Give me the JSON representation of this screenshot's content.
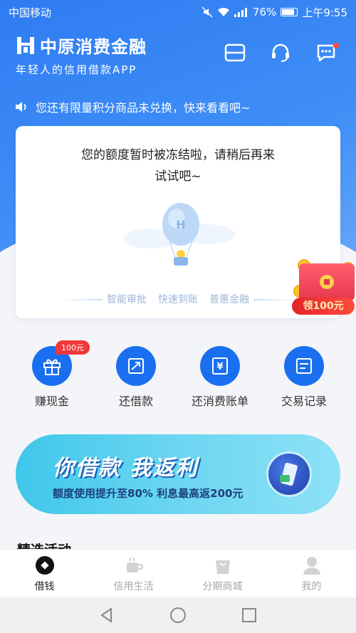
{
  "status_bar": {
    "carrier": "中国移动",
    "battery": "76%",
    "time": "上午9:55"
  },
  "header": {
    "brand_name": "中原消费金融",
    "tagline": "年轻人的信用借款APP",
    "icons": [
      "card-icon",
      "customer-service-icon",
      "message-icon"
    ]
  },
  "notice": {
    "text": "您还有限量积分商品未兑换，快来看看吧~"
  },
  "card": {
    "message_line1": "您的额度暂时被冻结啦，请稍后再来",
    "message_line2": "试试吧~",
    "features": [
      "智能审批",
      "快速到账",
      "普惠金融"
    ]
  },
  "floating_redpacket": {
    "label": "领100元"
  },
  "shortcuts": [
    {
      "label": "赚现金",
      "badge": "100元",
      "icon": "gift-icon"
    },
    {
      "label": "还借款",
      "icon": "repay-icon"
    },
    {
      "label": "还消费账单",
      "icon": "bill-icon"
    },
    {
      "label": "交易记录",
      "icon": "record-icon"
    }
  ],
  "banner": {
    "title": "你借款 我返利",
    "subtitle": "额度使用提升至80% 利息最高返200元"
  },
  "section": {
    "title": "精选活动"
  },
  "tabbar": [
    {
      "label": "借钱",
      "icon": "loan-icon",
      "active": true
    },
    {
      "label": "信用生活",
      "icon": "coffee-icon",
      "active": false
    },
    {
      "label": "分期商城",
      "icon": "shopping-bag-icon",
      "active": false
    },
    {
      "label": "我的",
      "icon": "profile-icon",
      "active": false
    }
  ],
  "colors": {
    "primary": "#2f7cf2",
    "icon_blue": "#1a6ff0",
    "badge_red": "#f0383a",
    "banner_cyan": "#3fc7ea"
  }
}
